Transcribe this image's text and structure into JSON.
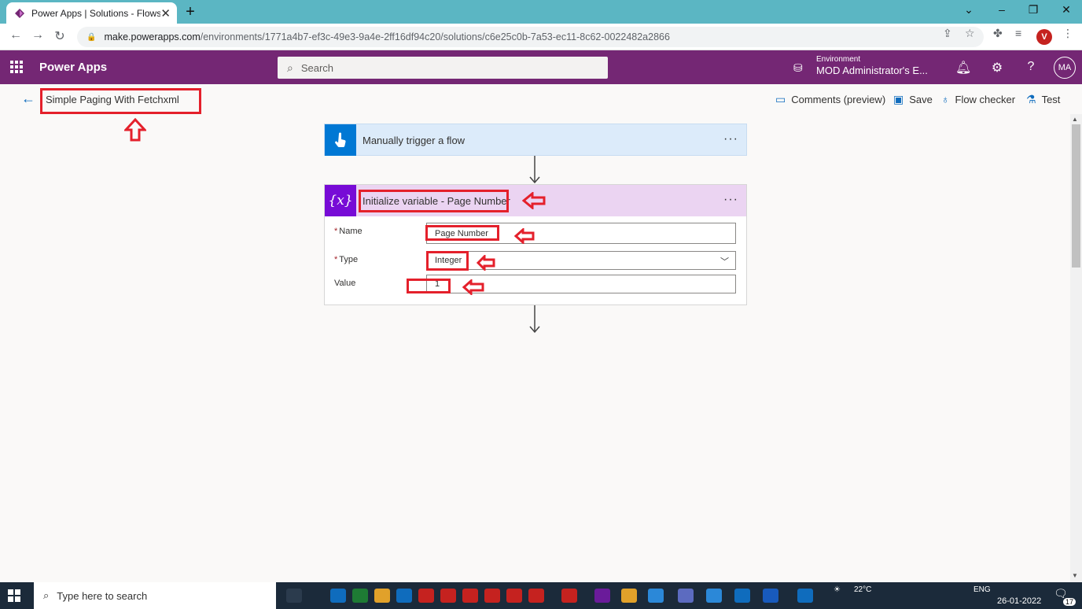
{
  "browser": {
    "tab_title": "Power Apps | Solutions - Flows",
    "url_host": "make.powerapps.com",
    "url_path": "/environments/1771a4b7-ef3c-49e3-9a4e-2ff16df94c20/solutions/c6e25c0b-7a53-ec11-8c62-0022482a2866",
    "profile_initial": "V"
  },
  "header": {
    "app_title": "Power Apps",
    "search_placeholder": "Search",
    "environment_label": "Environment",
    "environment_name": "MOD Administrator's E...",
    "avatar_initials": "MA"
  },
  "commandbar": {
    "flow_name": "Simple Paging With Fetchxml",
    "comments_label": "Comments (preview)",
    "save_label": "Save",
    "flow_checker_label": "Flow checker",
    "test_label": "Test"
  },
  "trigger_card": {
    "title": "Manually trigger a flow",
    "more_label": "···",
    "accent": "#0078d4"
  },
  "variable_card": {
    "title": "Initialize variable - Page Number",
    "more_label": "···",
    "icon_text": "{x}",
    "accent": "#770bd6",
    "fields": {
      "name_label": "Name",
      "name_value": "Page Number",
      "type_label": "Type",
      "type_value": "Integer",
      "value_label": "Value",
      "value_value": "1"
    }
  },
  "taskbar": {
    "search_placeholder": "Type here to search",
    "temperature": "22°C",
    "language": "ENG",
    "date": "26-01-2022",
    "notification_count": "17"
  },
  "colors": {
    "brand_purple": "#742774",
    "annotation_red": "#e4202b",
    "tab_strip": "#5bb6c3"
  }
}
